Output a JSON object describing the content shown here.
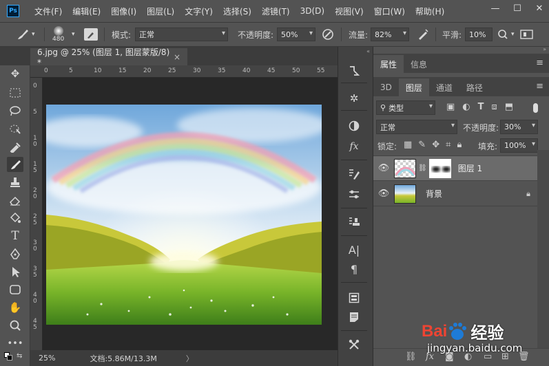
{
  "app": {
    "logo": "Ps"
  },
  "menu": [
    "文件(F)",
    "编辑(E)",
    "图像(I)",
    "图层(L)",
    "文字(Y)",
    "选择(S)",
    "滤镜(T)",
    "3D(D)",
    "视图(V)",
    "窗口(W)",
    "帮助(H)"
  ],
  "window_controls": {
    "minimize": "—",
    "maximize": "☐",
    "close": "✕"
  },
  "options": {
    "brush_size": "480",
    "mode_label": "模式:",
    "mode_value": "正常",
    "opacity_label": "不透明度:",
    "opacity_value": "50%",
    "flow_label": "流量:",
    "flow_value": "82%",
    "smooth_label": "平滑:",
    "smooth_value": "10%"
  },
  "document_tab": {
    "title": "6.jpg @ 25% (图层 1, 图层蒙版/8) *",
    "close": "×"
  },
  "rulers": {
    "top": [
      "0",
      "5",
      "10",
      "15",
      "20",
      "25",
      "30",
      "35",
      "40",
      "45",
      "50",
      "55"
    ],
    "left": [
      "0",
      "5",
      "1\n0",
      "1\n5",
      "2\n0",
      "2\n5",
      "3\n0",
      "3\n5",
      "4\n0",
      "4\n5"
    ]
  },
  "status": {
    "zoom": "25%",
    "doc": "文档:5.86M/13.3M",
    "arrow": "〉"
  },
  "panels": {
    "top_tabs": [
      "属性",
      "信息"
    ],
    "layer_tabs": [
      "3D",
      "图层",
      "通道",
      "路径"
    ],
    "filter_label": "类型",
    "blend_mode": "正常",
    "opacity_label": "不透明度:",
    "opacity_value": "30%",
    "lock_label": "锁定:",
    "fill_label": "填充:",
    "fill_value": "100%",
    "layers": [
      {
        "name": "图层 1",
        "selected": true
      },
      {
        "name": "背景",
        "selected": false,
        "locked": true
      }
    ]
  },
  "watermark": {
    "brand": "Bai",
    "brand2": "经验",
    "url": "jingyan.baidu.com"
  },
  "colors": {
    "ui_bg": "#535353",
    "canvas_bg": "#282828",
    "accent": "#31a8ff",
    "watermark": "#1e7bd6"
  }
}
